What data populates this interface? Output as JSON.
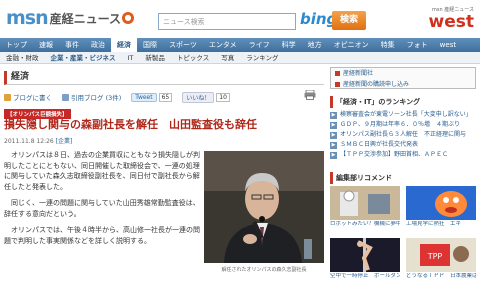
{
  "header": {
    "logo_msn": "msn",
    "logo_sankei": "産経ニュース",
    "search_placeholder": "ニュース検索",
    "bing": "bing",
    "search_button": "検索",
    "west_small": "msn 産経ニュース",
    "west_big": "west"
  },
  "nav": {
    "items": [
      "トップ",
      "速報",
      "事件",
      "政治",
      "経済",
      "国際",
      "スポーツ",
      "エンタメ",
      "ライフ",
      "科学",
      "地方",
      "オピニオン",
      "特集",
      "フォト",
      "west"
    ],
    "active_index": 4
  },
  "subnav": {
    "items": [
      "金融・財政",
      "企業・産業・ビジネス",
      "IT",
      "新製品",
      "トピックス",
      "写真",
      "ランキング"
    ],
    "active_index": 1
  },
  "section": {
    "title": "経済"
  },
  "share": {
    "blog": "ブログに書く",
    "quote": "引用ブログ (3件)",
    "tweet": "Tweet",
    "tweet_count": "65",
    "like": "いいね！",
    "like_count": "10"
  },
  "article": {
    "badge": "【オリンパス巨額損失】",
    "headline": "損失隠し関与の森副社長を解任　山田監査役も辞任",
    "date": "2011.11.8 12:26",
    "date_link": "[企業]",
    "paragraphs": [
      "オリンパスは８日、過去の企業買収にともなう損失隠しが判明したことにともない、同日開催した取締役会で、一連の処理に関与していた森久志取締役副社長を、同日付で副社長から解任したと発表した。",
      "同じく、一連の問題に関与していた山田秀雄常勤監査役は、辞任する意向だという。",
      "オリンパスでは、午後４時半から、高山修一社長が一連の問題で判明した事実関係などを詳しく説明する。"
    ],
    "photo_caption": "解任されたオリンパスの森久志副社長"
  },
  "right": {
    "ads": [
      "産経新聞社",
      "産経新聞の購読申し込み"
    ],
    "ranking_title": "「経済・IT」のランキング",
    "ranking": [
      "検察審査会が東電ソーン社長「大変申し訳ない」",
      "ＧＤＰ、９月期は年率６．０％増　４期ぶり",
      "オリンパス副社長ら３人解任　不正経理に関与",
      "ＳＭＢＣ日興が社長交代発表",
      "【ＴＰＰ交渉参加】野田首相、ＡＰＥＣ"
    ],
    "editor_title": "編集部リコメンド",
    "picks": [
      "ロボットみたい？機械に夢中",
      "工場見学に熱狂　エキ",
      "空中で一時停止　ポールダンス選手権",
      "どうなるＴＰＰ　日本農業は"
    ]
  }
}
